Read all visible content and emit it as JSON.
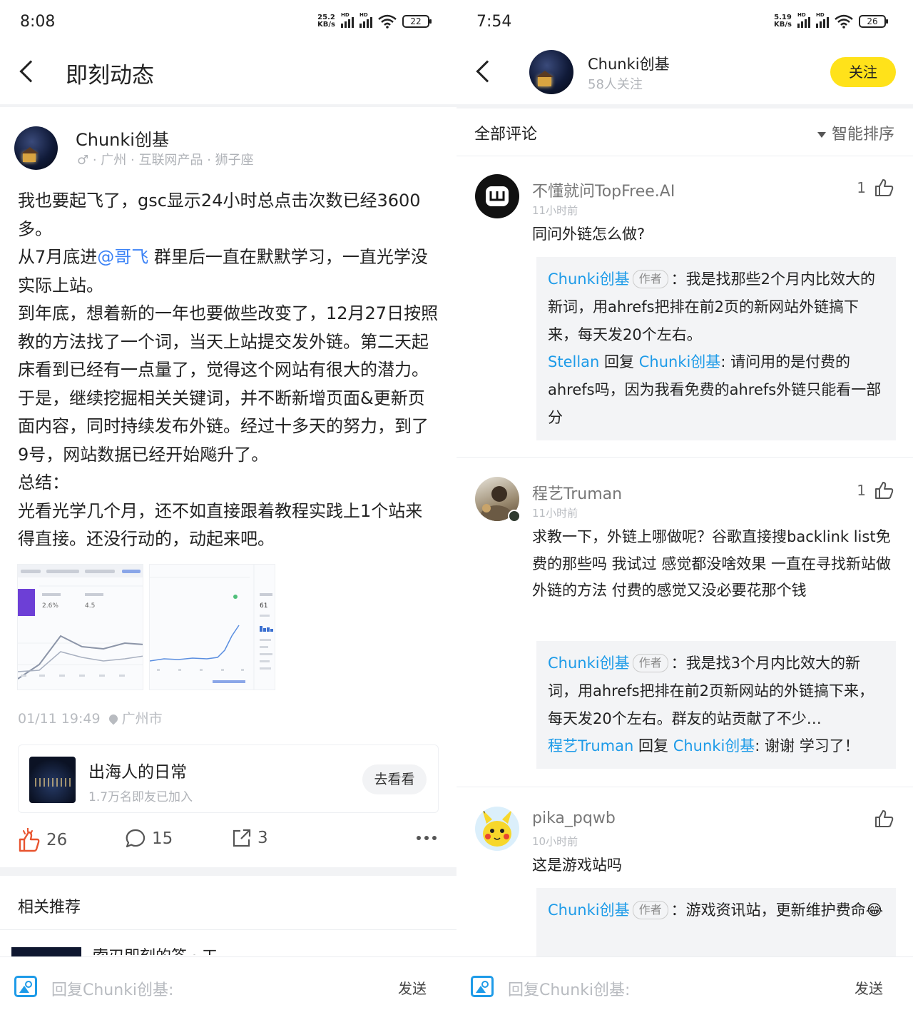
{
  "left": {
    "status": {
      "time": "8:08",
      "speed_top": "25.2",
      "speed_bottom": "KB/s",
      "battery": "22",
      "hd": "HD"
    },
    "header": {
      "title": "即刻动态"
    },
    "post": {
      "author": "Chunki创基",
      "meta": "♂ · 广州 · 互联网产品 · 狮子座",
      "paragraphs": [
        {
          "before": "我也要起飞了，gsc显示24小时总点击次数已经3600多。",
          "mention": "",
          "after": ""
        },
        {
          "before": "从7月底进",
          "mention": "@哥飞",
          "after": " 群里后一直在默默学习，一直光学没实际上站。"
        },
        {
          "before": "到年底，想着新的一年也要做些改变了，12月27日按照教的方法找了一个词，当天上站提交发外链。第二天起床看到已经有一点量了，觉得这个网站有很大的潜力。",
          "mention": "",
          "after": ""
        },
        {
          "before": "于是，继续挖掘相关关键词，并不断新增页面&更新页面内容，同时持续发布外链。经过十多天的努力，到了9号，网站数据已经开始飚升了。",
          "mention": "",
          "after": ""
        },
        {
          "before": "总结：",
          "mention": "",
          "after": ""
        },
        {
          "before": "光看光学几个月，还不如直接跟着教程实践上1个站来得直接。还没行动的，动起来吧。",
          "mention": "",
          "after": ""
        }
      ],
      "thumb1": {
        "ctr": "2.6%",
        "pos": "4.5"
      },
      "thumb2": {
        "value": "61"
      },
      "datetime": "01/11 19:49",
      "location": "广州市",
      "group": {
        "title": "出海人的日常",
        "subtitle": "1.7万名即友已加入",
        "button": "去看看"
      },
      "likes": "26",
      "comments": "15",
      "shares": "3"
    },
    "related": {
      "title": "相关推荐",
      "peek": "索刃即刻的答 · 工"
    },
    "reply": {
      "placeholder": "回复Chunki创基:",
      "send": "发送"
    }
  },
  "right": {
    "status": {
      "time": "7:54",
      "speed_top": "5.19",
      "speed_bottom": "KB/s",
      "battery": "26",
      "hd": "HD"
    },
    "header": {
      "name": "Chunki创基",
      "followers": "58人关注",
      "follow": "关注"
    },
    "sort": {
      "all": "全部评论",
      "order": "智能排序"
    },
    "comments": [
      {
        "name": "不懂就问TopFree.AI",
        "time": "11小时前",
        "likes": "1",
        "text": "同问外链怎么做?",
        "replies": [
          {
            "from": "Chunki创基",
            "tag": "作者",
            "to": "",
            "text": "：我是找那些2个月内比效大的新词，用ahrefs把排在前2页的新网站外链搞下来，每天发20个左右。"
          },
          {
            "from": "Stellan",
            "tag": "",
            "to": "Chunki创基",
            "text": ": 请问用的是付费的ahrefs吗，因为我看免费的ahrefs外链只能看一部分"
          }
        ]
      },
      {
        "name": "程艺Truman",
        "time": "11小时前",
        "likes": "1",
        "text": "求教一下，外链上哪做呢？谷歌直接搜backlink list免费的那些吗 我试过 感觉都没啥效果 一直在寻找新站做外链的方法 付费的感觉又没必要花那个钱",
        "replies": [
          {
            "from": "Chunki创基",
            "tag": "作者",
            "to": "",
            "text": "：我是找3个月内比效大的新词，用ahrefs把排在前2页新网站的外链搞下来，每天发20个左右。群友的站贡献了不少…"
          },
          {
            "from": "程艺Truman",
            "tag": "",
            "to": "Chunki创基",
            "text": ": 谢谢 学习了！"
          }
        ]
      },
      {
        "name": "pika_pqwb",
        "time": "10小时前",
        "likes": "",
        "text": "这是游戏站吗",
        "replies": [
          {
            "from": "Chunki创基",
            "tag": "作者",
            "to": "",
            "text": "：游戏资讯站，更新维护费命😂"
          }
        ]
      }
    ],
    "reply_word": "回复",
    "reply": {
      "placeholder": "回复Chunki创基:",
      "send": "发送"
    }
  },
  "colors": {
    "accent_blue": "#1e9be8",
    "mention_blue": "#3b82f6",
    "follow_yellow": "#ffe21a",
    "like_red": "#e8542f"
  }
}
